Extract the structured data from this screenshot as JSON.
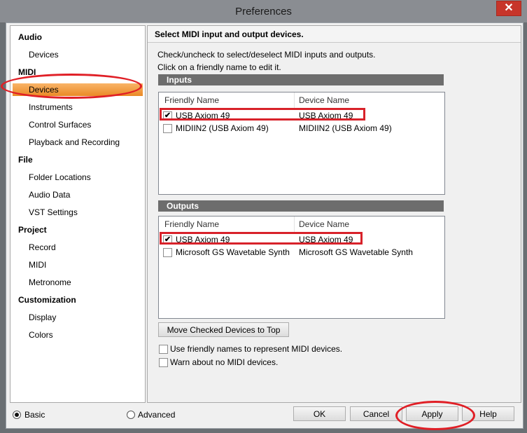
{
  "window": {
    "title": "Preferences",
    "close_glyph": "✕"
  },
  "sidebar": {
    "categories": [
      {
        "label": "Audio",
        "items": [
          "Devices"
        ]
      },
      {
        "label": "MIDI",
        "items": [
          "Devices",
          "Instruments",
          "Control Surfaces",
          "Playback and Recording"
        ]
      },
      {
        "label": "File",
        "items": [
          "Folder Locations",
          "Audio Data",
          "VST Settings"
        ]
      },
      {
        "label": "Project",
        "items": [
          "Record",
          "MIDI",
          "Metronome"
        ]
      },
      {
        "label": "Customization",
        "items": [
          "Display",
          "Colors"
        ]
      }
    ],
    "selected": "MIDI > Devices"
  },
  "content": {
    "header": "Select MIDI input and output devices.",
    "instruction_1": "Check/uncheck to select/deselect MIDI inputs and outputs.",
    "instruction_2": "Click on a friendly name to edit it.",
    "inputs": {
      "title": "Inputs",
      "columns": [
        "Friendly Name",
        "Device Name"
      ],
      "rows": [
        {
          "friendly": "USB Axiom 49",
          "device": "USB Axiom 49",
          "checked": true
        },
        {
          "friendly": "MIDIIN2 (USB Axiom 49)",
          "device": "MIDIIN2 (USB Axiom 49)",
          "checked": false
        }
      ]
    },
    "outputs": {
      "title": "Outputs",
      "columns": [
        "Friendly Name",
        "Device Name"
      ],
      "rows": [
        {
          "friendly": "USB Axiom 49",
          "device": "USB Axiom 49",
          "checked": true
        },
        {
          "friendly": "Microsoft GS Wavetable Synth",
          "device": "Microsoft GS Wavetable Synth",
          "checked": false
        }
      ]
    },
    "move_button": "Move Checked Devices to Top",
    "option_friendly_names": "Use friendly names to represent MIDI devices.",
    "option_warn": "Warn about no MIDI devices."
  },
  "footer": {
    "mode_basic": "Basic",
    "mode_advanced": "Advanced",
    "selected_mode": "Basic",
    "ok": "OK",
    "cancel": "Cancel",
    "apply": "Apply",
    "help": "Help"
  },
  "check_glyph": "✔",
  "annotation_color": "#d8222a"
}
